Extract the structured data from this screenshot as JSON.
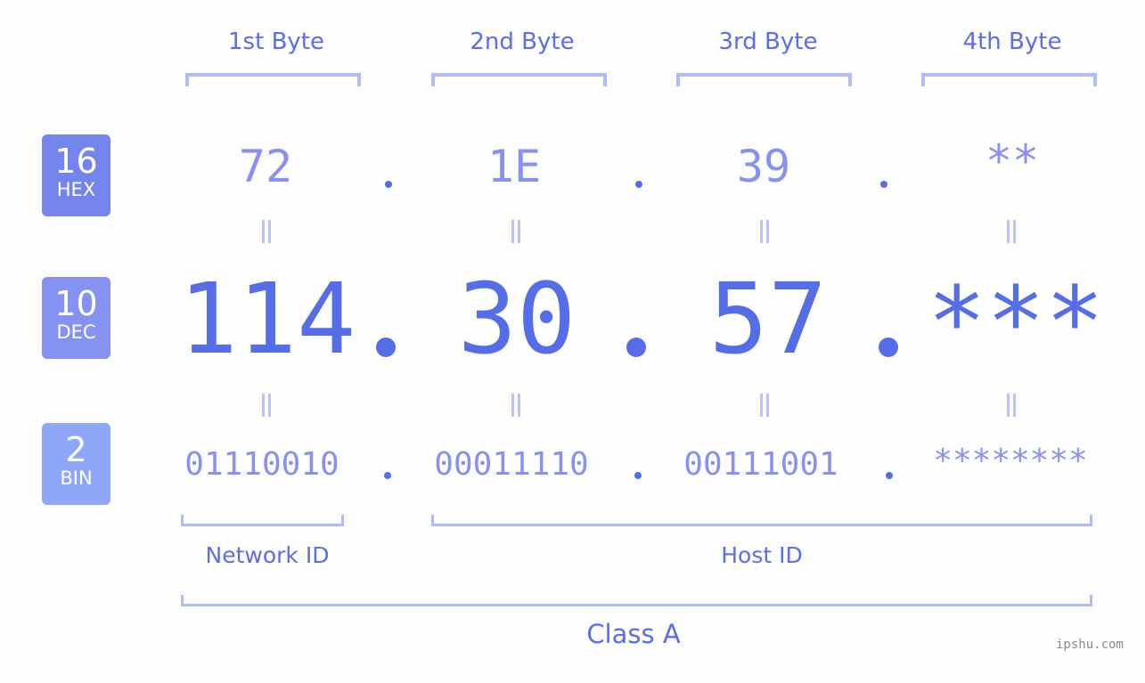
{
  "byte_headers": [
    "1st Byte",
    "2nd Byte",
    "3rd Byte",
    "4th Byte"
  ],
  "bases": [
    {
      "number": "16",
      "label": "HEX",
      "color": "#7584ec"
    },
    {
      "number": "10",
      "label": "DEC",
      "color": "#8592f0"
    },
    {
      "number": "2",
      "label": "BIN",
      "color": "#8ea7f8"
    }
  ],
  "hex_values": [
    "72",
    "1E",
    "39",
    "**"
  ],
  "dec_values": [
    "114",
    "30",
    "57",
    "***"
  ],
  "bin_values": [
    "01110010",
    "00011110",
    "00111001",
    "********"
  ],
  "separator": ".",
  "network_id_label": "Network ID",
  "host_id_label": "Host ID",
  "class_label": "Class A",
  "watermark": "ipshu.com",
  "colors": {
    "accent": "#566de8",
    "light_value": "#8892ee",
    "bracket": "#b1bbf7",
    "background": "#fcfdfc"
  }
}
